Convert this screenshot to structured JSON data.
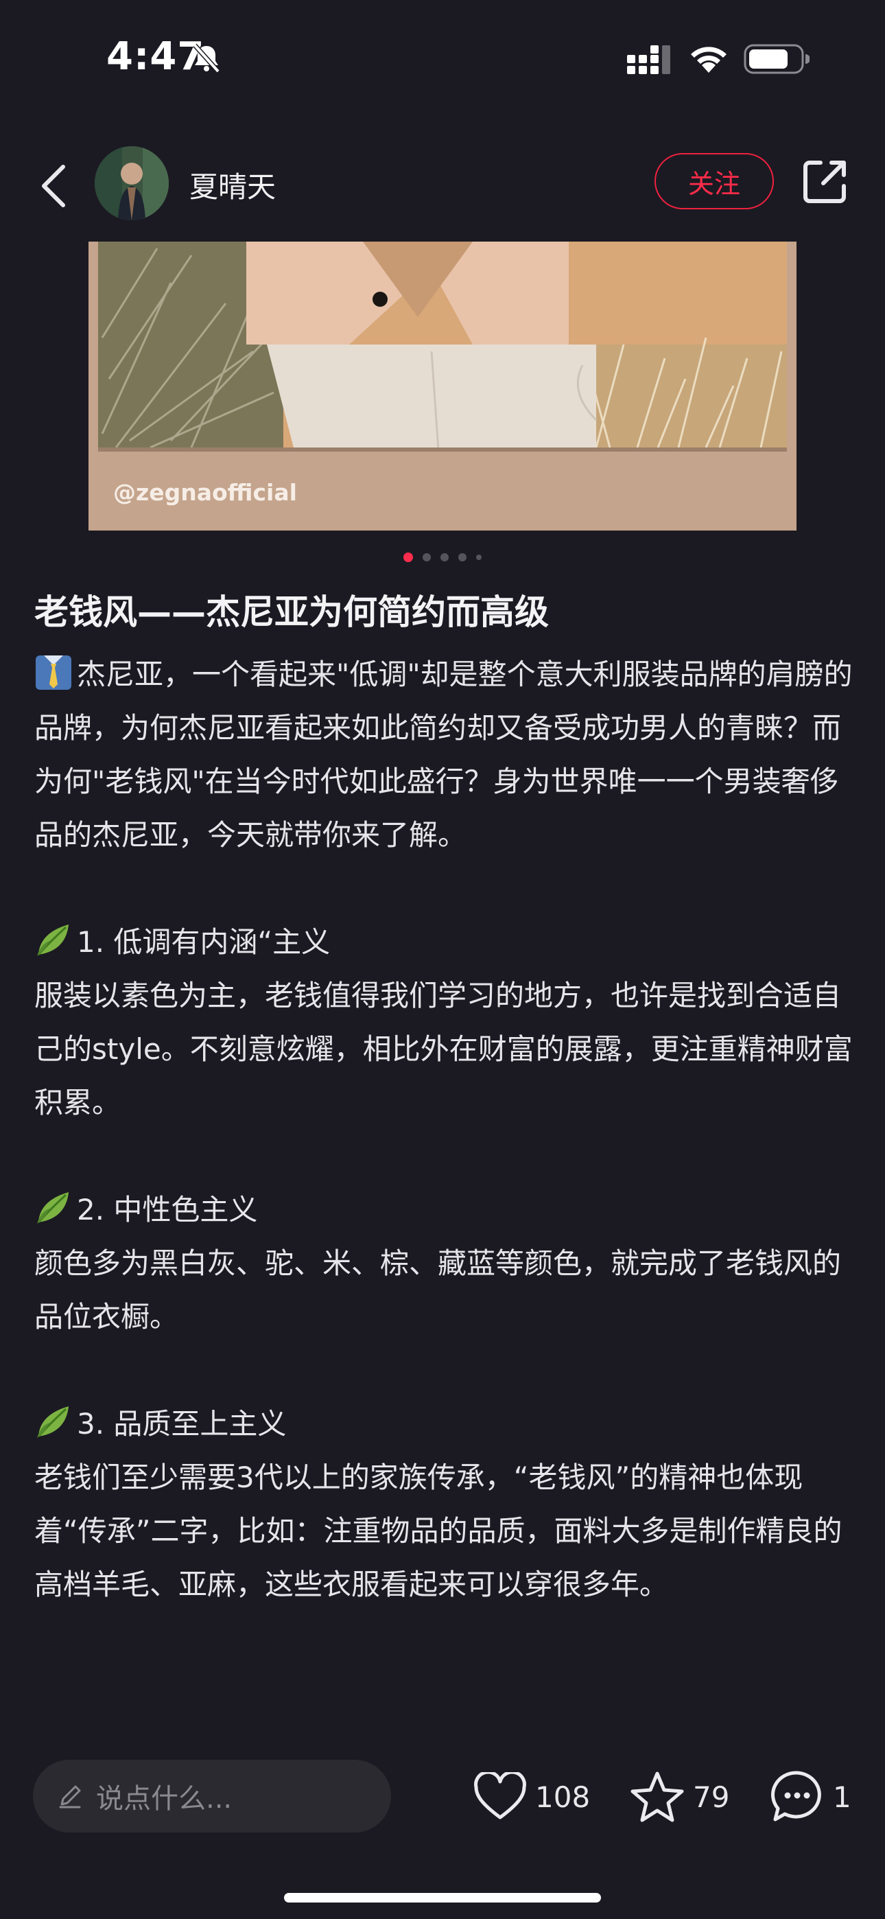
{
  "status_bar": {
    "time": "4:47"
  },
  "nav": {
    "author_name": "夏晴天",
    "follow_label": "关注"
  },
  "image": {
    "watermark": "@zegnaofficial",
    "page_count": 5,
    "active_page": 1
  },
  "post": {
    "title": "老钱风——杰尼亚为何简约而高级",
    "intro": "杰尼亚，一个看起来\"低调\"却是整个意大利服装品牌的肩膀的品牌，为何杰尼亚看起来如此简约却又备受成功男人的青睐？而为何\"老钱风\"在当今时代如此盛行？身为世界唯一一个男装奢侈品的杰尼亚，今天就带你来了解。",
    "sections": [
      {
        "heading": "1. 低调有内涵“主义",
        "text": "服装以素色为主，老钱值得我们学习的地方，也许是找到合适自己的style。不刻意炫耀，相比外在财富的展露，更注重精神财富积累。"
      },
      {
        "heading": "2. 中性色主义",
        "text": "颜色多为黑白灰、驼、米、棕、藏蓝等颜色，就完成了老钱风的品位衣橱。"
      },
      {
        "heading": "3. 品质至上主义",
        "text": "老钱们至少需要3代以上的家族传承，“老钱风”的精神也体现着“传承”二字，比如：注重物品的品质，面料大多是制作精良的高档羊毛、亚麻，这些衣服看起来可以穿很多年。"
      }
    ]
  },
  "bottom_bar": {
    "comment_placeholder": "说点什么...",
    "like_count": "108",
    "collect_count": "79",
    "comment_count": "1"
  },
  "colors": {
    "accent": "#ff2442",
    "background": "#1b1a22"
  },
  "icons": {
    "intro": "necktie-shirt-emoji",
    "section": "leaf-emoji",
    "back": "chevron-left-icon",
    "share": "share-icon",
    "like": "heart-icon",
    "collect": "star-icon",
    "comment": "comment-bubble-icon"
  }
}
